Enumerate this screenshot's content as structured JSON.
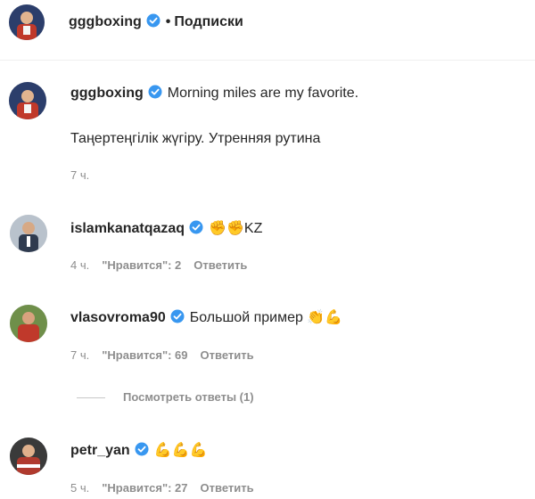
{
  "header": {
    "username": "gggboxing",
    "separator": "•",
    "follow_status": "Подписки"
  },
  "post": {
    "username": "gggboxing",
    "caption_line1": "Morning miles are my favorite.",
    "caption_line2": "Таңертеңгілік жүгіру. Утренняя рутина",
    "time": "7 ч."
  },
  "comments": [
    {
      "username": "islamkanatqazaq",
      "text": "✊✊KZ",
      "time": "4 ч.",
      "likes": "\"Нравится\": 2",
      "reply": "Ответить"
    },
    {
      "username": "vlasovroma90",
      "text": "Большой пример 👏💪",
      "time": "7 ч.",
      "likes": "\"Нравится\": 69",
      "reply": "Ответить"
    },
    {
      "username": "petr_yan",
      "text": "💪💪💪",
      "time": "5 ч.",
      "likes": "\"Нравится\": 27",
      "reply": "Ответить"
    }
  ],
  "view_replies": "Посмотреть ответы (1)",
  "icons": {
    "verified": "verified-badge-icon",
    "verified_color": "#3897f0"
  }
}
